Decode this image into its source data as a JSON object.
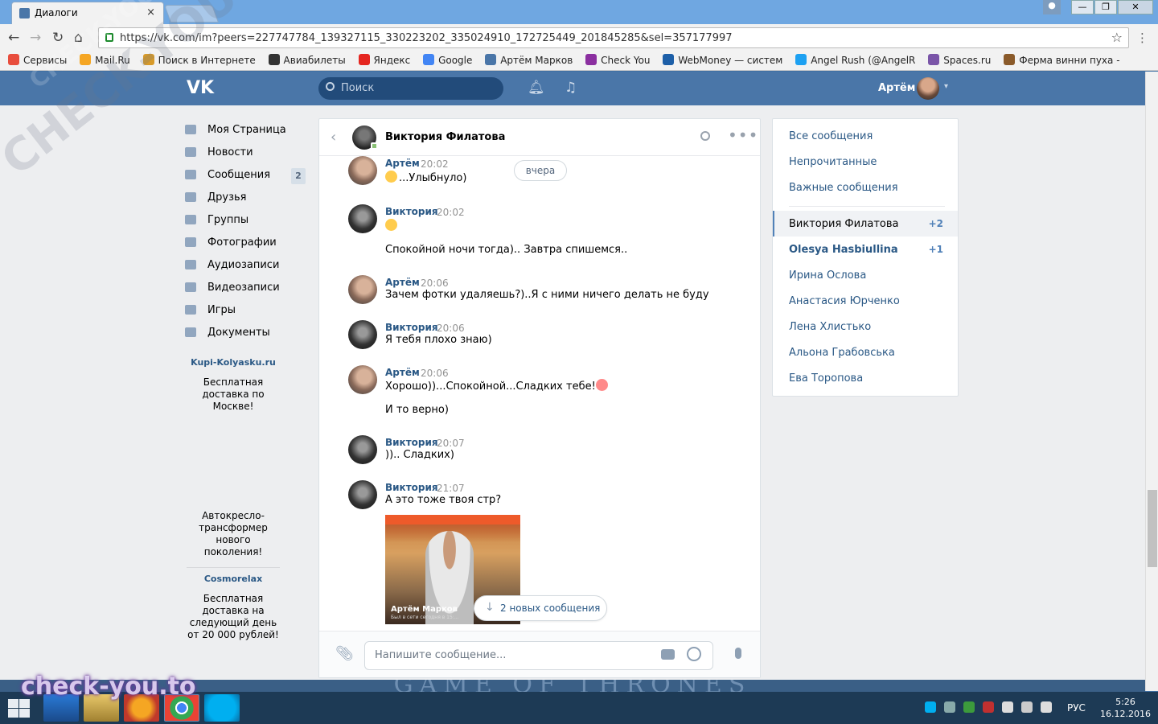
{
  "browser": {
    "tab_title": "Диалоги",
    "tab_close": "×",
    "url": "https://vk.com/im?peers=227747784_139327115_330223202_335024910_172725449_201845285&sel=357177997",
    "bookmarks": [
      {
        "label": "Сервисы",
        "color": "#e84d3d"
      },
      {
        "label": "Mail.Ru",
        "color": "#f5a623"
      },
      {
        "label": "Поиск в Интернете",
        "color": "#d79a2a"
      },
      {
        "label": "Авиабилеты",
        "color": "#333333"
      },
      {
        "label": "Яндекс",
        "color": "#e52620"
      },
      {
        "label": "Google",
        "color": "#4285f4"
      },
      {
        "label": "Артём Марков",
        "color": "#4a76a8"
      },
      {
        "label": "Check You",
        "color": "#8b2fa0"
      },
      {
        "label": "WebMoney — систем",
        "color": "#1d5fa8"
      },
      {
        "label": "Angel Rush (@AngelR",
        "color": "#1da1f2"
      },
      {
        "label": "Spaces.ru",
        "color": "#7a55a8"
      },
      {
        "label": "Ферма винни пуха -",
        "color": "#8a5a2a"
      }
    ]
  },
  "vk": {
    "logo": "VK",
    "search_placeholder": "Поиск",
    "user_name": "Артём",
    "caret": "▾"
  },
  "leftnav": [
    {
      "label": "Моя Страница",
      "icon": "home-icon"
    },
    {
      "label": "Новости",
      "icon": "news-icon"
    },
    {
      "label": "Сообщения",
      "icon": "messages-icon",
      "badge": "2"
    },
    {
      "label": "Друзья",
      "icon": "friends-icon"
    },
    {
      "label": "Группы",
      "icon": "groups-icon"
    },
    {
      "label": "Фотографии",
      "icon": "camera-icon"
    },
    {
      "label": "Аудиозаписи",
      "icon": "music-icon"
    },
    {
      "label": "Видеозаписи",
      "icon": "video-icon"
    },
    {
      "label": "Игры",
      "icon": "gamepad-icon"
    },
    {
      "label": "Документы",
      "icon": "document-icon"
    }
  ],
  "ads": [
    {
      "title": "Kupi-Kolyasku.ru",
      "text": "Бесплатная доставка по Москве!"
    },
    {
      "title": "",
      "text": "Автокресло-трансформер нового поколения!"
    },
    {
      "title": "Cosmorelax",
      "text": "Бесплатная доставка на следующий день от 20 000 рублей!"
    }
  ],
  "chat": {
    "peer_name": "Виктория Филатова",
    "day_label": "вчера",
    "messages": [
      {
        "author": "Артём",
        "time": "20:02",
        "lines": [
          "...Улыбнуло)"
        ]
      },
      {
        "author": "Виктория",
        "time": "20:02",
        "lines": [
          "",
          "Спокойной ночи тогда).. Завтра спишемся.."
        ]
      },
      {
        "author": "Артём",
        "time": "20:06",
        "lines": [
          "Зачем фотки удаляешь?)..Я с ними ничего делать не буду"
        ]
      },
      {
        "author": "Виктория",
        "time": "20:06",
        "lines": [
          "Я тебя плохо знаю)"
        ]
      },
      {
        "author": "Артём",
        "time": "20:06",
        "lines": [
          "Хорошо))...Спокойной...Сладких тебе!",
          "И то верно)"
        ]
      },
      {
        "author": "Виктория",
        "time": "20:07",
        "lines": [
          "))..  Сладких)"
        ]
      },
      {
        "author": "Виктория",
        "time": "21:07",
        "lines": [
          "А это тоже твоя стр?"
        ]
      }
    ],
    "photo_caption": "Артём Марков",
    "photo_subcaption": "Был в сети сегодня в 15:...",
    "new_messages": "2 новых сообщения",
    "compose_placeholder": "Напишите сообщение..."
  },
  "right": {
    "filters": [
      "Все сообщения",
      "Непрочитанные",
      "Важные сообщения"
    ],
    "contacts": [
      {
        "name": "Виктория Филатова",
        "count": "+2"
      },
      {
        "name": "Olesya Hasbiullina",
        "count": "+1"
      },
      {
        "name": "Ирина Ослова",
        "count": ""
      },
      {
        "name": "Анастасия Юрченко",
        "count": ""
      },
      {
        "name": "Лена Хлистько",
        "count": ""
      },
      {
        "name": "Альона Грабовська",
        "count": ""
      },
      {
        "name": "Ева Торопова",
        "count": ""
      }
    ]
  },
  "background_banner": "GAME OF THRONES",
  "taskbar": {
    "lang": "РУС",
    "time": "5:26",
    "date": "16.12.2016"
  },
  "watermarks": {
    "diagonal": "CHECK-YOU.ME",
    "corner": "check-you.to"
  },
  "colors": {
    "vk_blue": "#4a76a8",
    "link": "#2a5885",
    "page_bg": "#edeef0"
  }
}
